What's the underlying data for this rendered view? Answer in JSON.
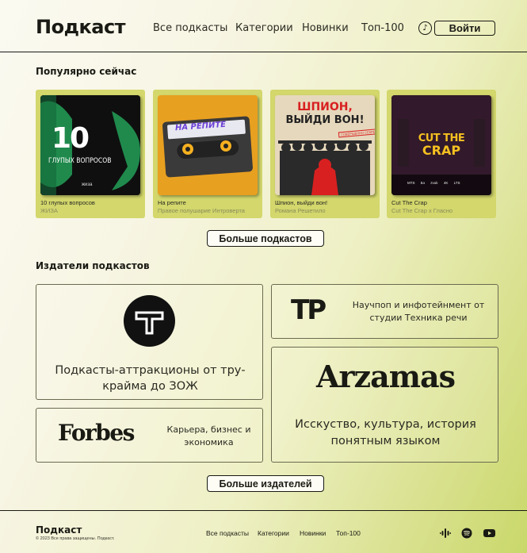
{
  "header": {
    "logo": "Подкаст",
    "nav": [
      "Все подкасты",
      "Категории",
      "Новинки",
      "Топ-100"
    ],
    "music_icon": "music-note-icon",
    "login": "Войти"
  },
  "popular": {
    "title": "Популярно сейчас",
    "cards": [
      {
        "title": "10 глупых вопросов",
        "subtitle": "ЖИЗА",
        "cover_big": "10",
        "cover_text": "ГЛУПЫХ ВОПРОСОВ",
        "cover_brand": "жиза"
      },
      {
        "title": "На репите",
        "subtitle": "Правое полушарие Интроверта",
        "cover_text": "НА РЕПИТЕ"
      },
      {
        "title": "Шпион, выйди вон!",
        "subtitle": "Романа Решетило",
        "cover_line1": "ШПИОН,",
        "cover_line2": "ВЫЙДИ ВОН!",
        "cover_stamp": "СОВЕРШЕННО СЕКРЕТНО"
      },
      {
        "title": "Cut The Crap",
        "subtitle": "Cut The Crap x Гласно",
        "cover_line1": "CUT THE",
        "cover_line2": "CRAP",
        "cover_tags": [
          "MTS",
          "Бэ",
          "zvuk",
          "4K",
          "LTS"
        ]
      }
    ],
    "more": "Больше подкастов"
  },
  "publishers": {
    "title": "Издатели подкастов",
    "items": [
      {
        "name": "T-logo",
        "desc": "Подкасты-аттракционы от тру-крайма до ЗОЖ"
      },
      {
        "name": "TP",
        "desc": "Научпоп и инфотейнмент от студии Техника речи"
      },
      {
        "name": "Arzamas",
        "desc": "Исскуство, культура, история понятным языком"
      },
      {
        "name": "Forbes",
        "desc": "Карьера, бизнес и экономика"
      }
    ],
    "more": "Больше издателей"
  },
  "footer": {
    "logo": "Подкаст",
    "copyright": "© 2023 Все права защищены. Подкаст.",
    "nav": [
      "Все подкасты",
      "Категории",
      "Новинки",
      "Топ-100"
    ],
    "icons": [
      "podcasts-icon",
      "spotify-icon",
      "youtube-icon"
    ]
  },
  "colors": {
    "card_bg": "#d3d76c",
    "text": "#1a1a14",
    "accent_green": "#c9d86a"
  }
}
